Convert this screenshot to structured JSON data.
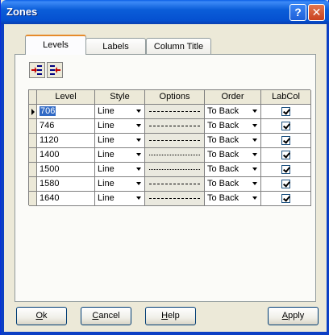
{
  "window": {
    "title": "Zones",
    "help_glyph": "?",
    "close_glyph": "✕"
  },
  "tabs": [
    {
      "label": "Levels",
      "selected": true
    },
    {
      "label": "Labels",
      "selected": false
    },
    {
      "label": "Column Title",
      "selected": false
    }
  ],
  "toolbar": [
    {
      "icon": "add-level-icon"
    },
    {
      "icon": "remove-level-icon"
    }
  ],
  "grid": {
    "columns": [
      "Level",
      "Style",
      "Options",
      "Order",
      "LabCol"
    ],
    "rows": [
      {
        "level": "706",
        "style": "Line",
        "options": "dashed",
        "order": "To Back",
        "labcol": true,
        "current": true
      },
      {
        "level": "746",
        "style": "Line",
        "options": "dashed",
        "order": "To Back",
        "labcol": true
      },
      {
        "level": "1120",
        "style": "Line",
        "options": "dashed",
        "order": "To Back",
        "labcol": true
      },
      {
        "level": "1400",
        "style": "Line",
        "options": "dotted",
        "order": "To Back",
        "labcol": true
      },
      {
        "level": "1500",
        "style": "Line",
        "options": "dotted",
        "order": "To Back",
        "labcol": true
      },
      {
        "level": "1580",
        "style": "Line",
        "options": "dashed",
        "order": "To Back",
        "labcol": true
      },
      {
        "level": "1640",
        "style": "Line",
        "options": "dashed",
        "order": "To Back",
        "labcol": true
      }
    ]
  },
  "buttons": {
    "ok": {
      "mnemonic": "O",
      "rest": "k"
    },
    "cancel": {
      "mnemonic": "C",
      "rest": "ancel"
    },
    "help": {
      "mnemonic": "H",
      "rest": "elp"
    },
    "apply": {
      "mnemonic": "A",
      "rest": "pply"
    }
  }
}
